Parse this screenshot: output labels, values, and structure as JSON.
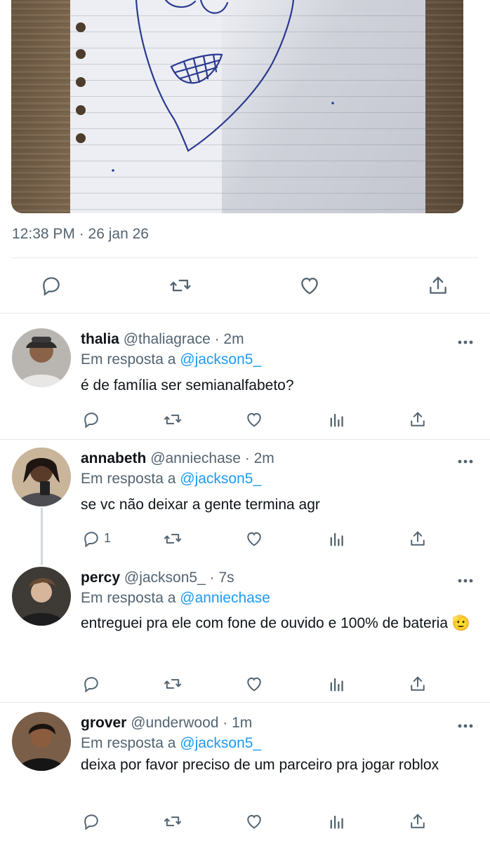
{
  "tweet": {
    "timestamp": "12:38 PM · 26 jan 26",
    "actions": [
      "reply-icon",
      "retweet-icon",
      "like-icon",
      "share-icon"
    ]
  },
  "replies": [
    {
      "name": "thalia",
      "handle": "@thaliagrace",
      "time": "· 2m",
      "in_reply_prefix": "Em resposta a",
      "in_reply_to": "@jackson5_",
      "text": "é de família ser semianalfabeto?",
      "reply_count": ""
    },
    {
      "name": "annabeth",
      "handle": "@anniechase",
      "time": "· 2m",
      "in_reply_prefix": "Em resposta a",
      "in_reply_to": "@jackson5_",
      "text": "se vc não deixar a gente termina agr",
      "reply_count": "1"
    },
    {
      "name": "percy",
      "handle": "@jackson5_",
      "time": "· 7s",
      "in_reply_prefix": "Em resposta a",
      "in_reply_to": "@anniechase",
      "text": "entreguei pra ele com fone de ouvido e 100% de bateria 🫡",
      "reply_count": ""
    },
    {
      "name": "grover",
      "handle": "@underwood",
      "time": "· 1m",
      "in_reply_prefix": "Em resposta a",
      "in_reply_to": "@jackson5_",
      "text": "deixa por favor preciso de um parceiro pra jogar roblox",
      "reply_count": ""
    }
  ],
  "colors": {
    "accent": "#1d9bf0",
    "secondary_text": "#536471",
    "divider": "#e6e9ec"
  }
}
